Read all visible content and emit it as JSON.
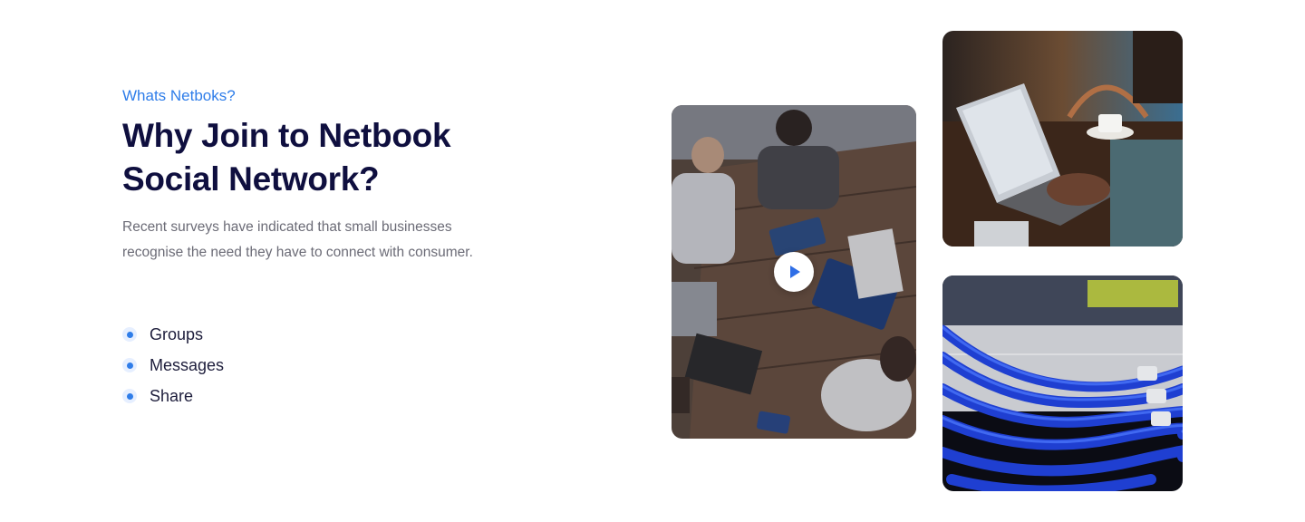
{
  "section": {
    "eyebrow": "Whats Netboks?",
    "title": "Why Join to Netbook Social Network?",
    "description": "Recent surveys have indicated that small businesses recognise the need they have to connect with consumer.",
    "features": [
      {
        "label": "Groups"
      },
      {
        "label": "Messages"
      },
      {
        "label": "Share"
      }
    ]
  },
  "media": {
    "images": [
      {
        "name": "team-meeting-photo"
      },
      {
        "name": "laptop-coffee-photo"
      },
      {
        "name": "network-cables-photo"
      }
    ],
    "play_icon": "play-icon"
  },
  "colors": {
    "accent": "#2f7de9",
    "heading": "#0f0f3f",
    "body_text": "#6b6b76",
    "background": "#ffffff"
  }
}
